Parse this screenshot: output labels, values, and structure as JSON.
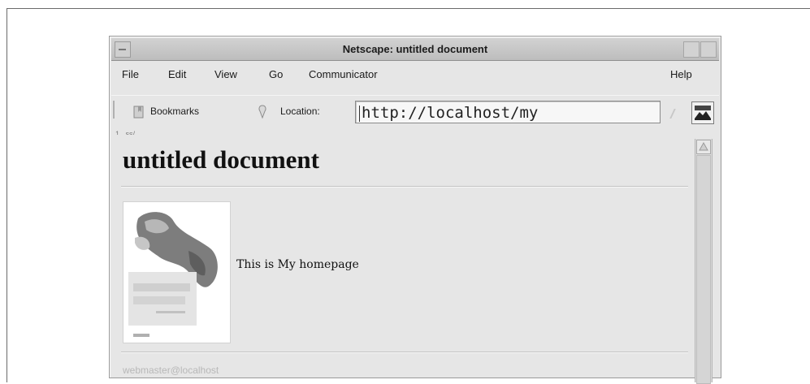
{
  "window": {
    "title": "Netscape: untitled document"
  },
  "menubar": {
    "items": [
      "File",
      "Edit",
      "View",
      "Go",
      "Communicator"
    ],
    "help": "Help"
  },
  "toolbar": {
    "bookmarks_label": "Bookmarks",
    "location_label": "Location:",
    "url": "http://localhost/my"
  },
  "status": {
    "fragment": "1...ss/"
  },
  "page": {
    "heading": "untitled document",
    "text": "This is My homepage",
    "footer_text": "webmaster@localhost"
  },
  "icons": {
    "window_menu": "window-menu-icon",
    "bookmarks": "bookmark-icon",
    "location": "location-icon",
    "throbber": "netscape-throbber-icon",
    "cover": "book-cover-image"
  },
  "colors": {
    "window_bg": "#e6e6e6",
    "titlebar": "#c8c8c8",
    "text": "#111111"
  }
}
